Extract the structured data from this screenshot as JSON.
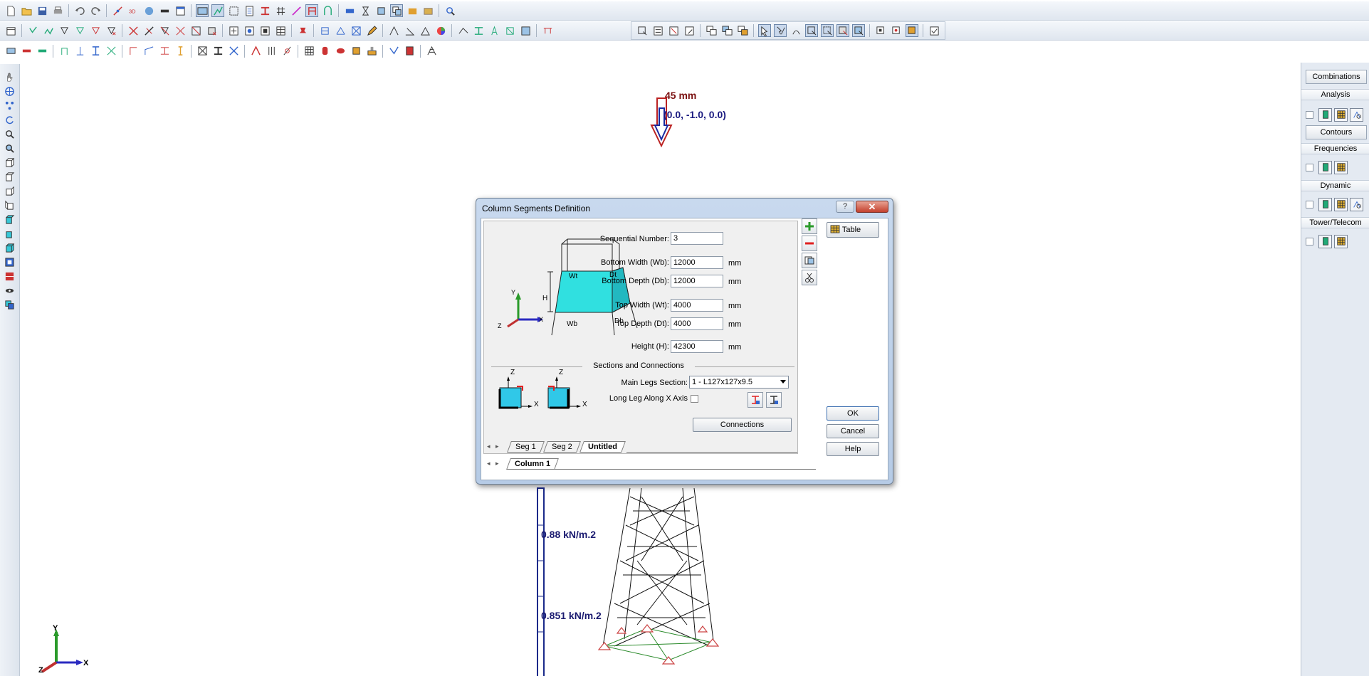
{
  "canvas": {
    "load_value": "45 mm",
    "load_vector": "(0.0, -1.0, 0.0)",
    "pressure_top": "0.88 kN/m.2",
    "pressure_bottom": "0.851 kN/m.2",
    "axis_y": "Y",
    "axis_x": "X",
    "axis_z": "Z"
  },
  "right_panel": {
    "combinations": "Combinations",
    "analysis": "Analysis",
    "contours": "Contours",
    "frequencies": "Frequencies",
    "dynamic": "Dynamic",
    "tower_telecom": "Tower/Telecom"
  },
  "dialog": {
    "title": "Column Segments Definition",
    "help_glyph": "?",
    "close_glyph": "✕",
    "fields": {
      "sequential_number": {
        "label": "Sequential Number:",
        "value": "3"
      },
      "bottom_width": {
        "label": "Bottom Width (Wb):",
        "value": "12000",
        "unit": "mm"
      },
      "bottom_depth": {
        "label": "Bottom Depth (Db):",
        "value": "12000",
        "unit": "mm"
      },
      "top_width": {
        "label": "Top Width (Wt):",
        "value": "4000",
        "unit": "mm"
      },
      "top_depth": {
        "label": "Top Depth (Dt):",
        "value": "4000",
        "unit": "mm"
      },
      "height": {
        "label": "Height (H):",
        "value": "42300",
        "unit": "mm"
      }
    },
    "diagram": {
      "wt": "Wt",
      "dt": "Dt",
      "wb": "Wb",
      "db": "Db",
      "h": "H",
      "x": "X",
      "y": "Y",
      "z": "Z"
    },
    "sections_title": "Sections and Connections",
    "main_legs_label": "Main Legs Section:",
    "main_legs_value": "1 - L127x127x9.5",
    "long_leg_label": "Long Leg Along X Axis",
    "long_leg_checked": false,
    "connections_button": "Connections",
    "table_button": "Table",
    "ok_button": "OK",
    "cancel_button": "Cancel",
    "help_button": "Help",
    "segment_tabs": [
      "Seg 1",
      "Seg 2",
      "Untitled"
    ],
    "active_segment_tab": "Untitled",
    "column_tabs": [
      "Column 1"
    ]
  }
}
